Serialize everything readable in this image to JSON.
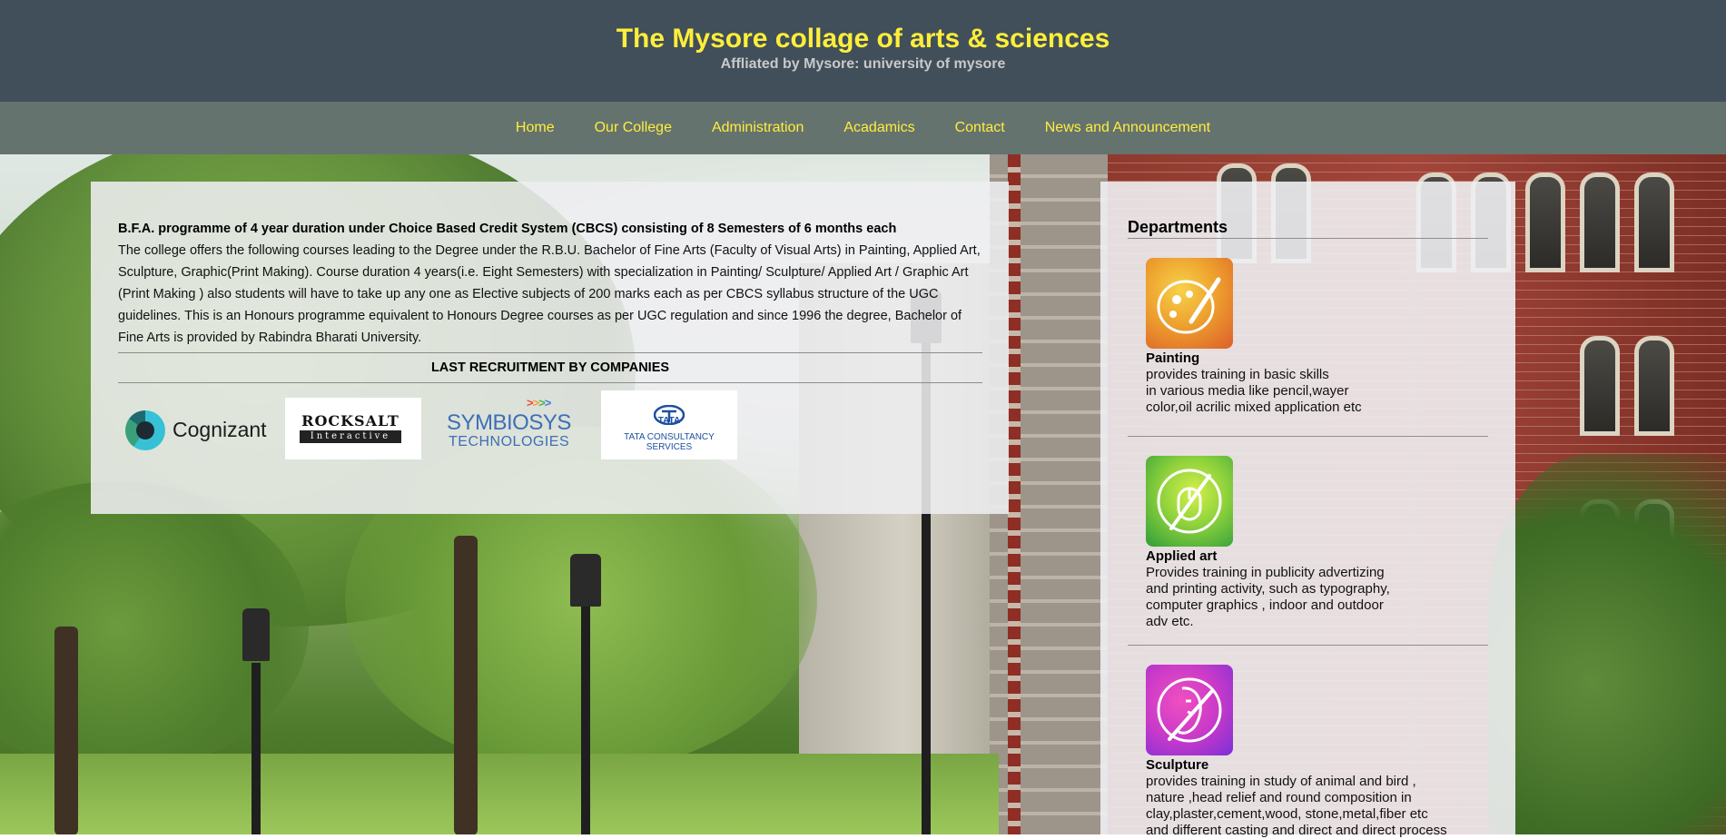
{
  "header": {
    "title": "The Mysore collage of arts & sciences",
    "subtitle": "Affliated by Mysore: university of mysore"
  },
  "nav": {
    "items": [
      "Home",
      "Our College",
      "Administration",
      "Acadamics",
      "Contact",
      "News and Announcement"
    ]
  },
  "intro": {
    "heading": "B.F.A. programme of 4 year duration under Choice Based Credit System (CBCS) consisting of 8 Semesters of 6 months each",
    "body": "The college offers the following courses leading to the Degree under the R.B.U. Bachelor of Fine Arts (Faculty of Visual Arts) in Painting, Applied Art, Sculpture, Graphic(Print Making). Course duration 4 years(i.e. Eight Semesters) with specialization in Painting/ Sculpture/ Applied Art / Graphic Art (Print Making ) also students will have to take up any one as Elective subjects of 200 marks each as per CBCS syllabus structure of the UGC guidelines. This is an Honours programme equivalent to Honours Degree courses as per UGC regulation and since 1996 the degree, Bachelor of Fine Arts is provided by Rabindra Bharati University.",
    "recruit_heading": "LAST RECRUITMENT BY COMPANIES"
  },
  "logos": {
    "cognizant": "Cognizant",
    "rocksalt_top": "ROCKSALT",
    "rocksalt_bottom": "Interactive",
    "symbiosys_arrows": ">>>>",
    "symbiosys_name": "SYMBIOSYS",
    "symbiosys_sub": "TECHNOLOGIES",
    "tcs_word": "TATA",
    "tcs_full": "TATA CONSULTANCY SERVICES"
  },
  "departments": {
    "title": "Departments",
    "items": [
      {
        "name": "Painting",
        "desc": "provides training in basic skills\nin various media like pencil,wayer\ncolor,oil acrilic mixed application etc",
        "icon": "palette-icon",
        "colors": [
          "#f2c230",
          "#e9762c"
        ]
      },
      {
        "name": "Applied art",
        "desc": "Provides training in publicity advertizing\nand printing activity, such as typography,\ncomputer graphics , indoor and outdoor\nadv etc.",
        "icon": "mouse-brush-icon",
        "colors": [
          "#b7e33a",
          "#3fae3a"
        ]
      },
      {
        "name": "Sculpture",
        "desc": "provides training in study of animal and bird ,\nnature ,head relief and round composition in\nclay,plaster,cement,wood, stone,metal,fiber etc\nand different casting and direct and direct process",
        "icon": "sculpture-face-icon",
        "colors": [
          "#e63bb8",
          "#8a32d8"
        ]
      }
    ]
  },
  "colors": {
    "header_bg": "#404f59",
    "nav_bg": "#65736f",
    "accent_yellow": "#ffee3a"
  }
}
